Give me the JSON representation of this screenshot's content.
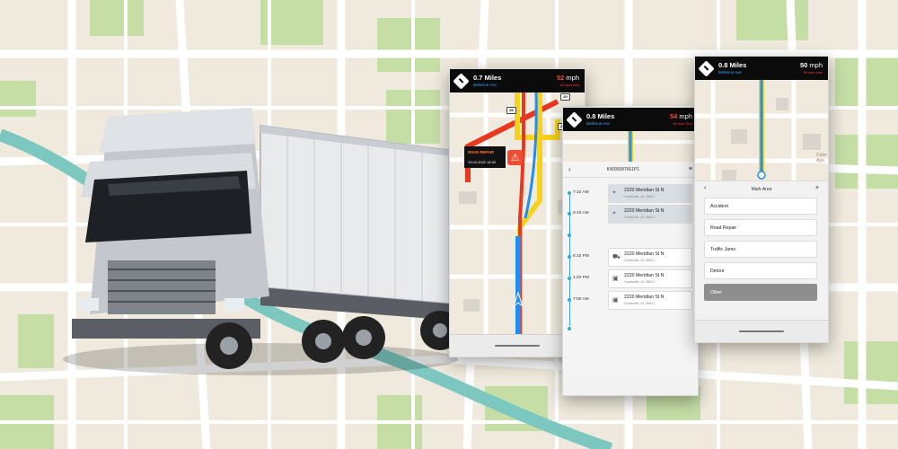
{
  "phone1": {
    "nav": {
      "distance": "0.7 Miles",
      "street": "Bellevue Ave",
      "speed_value": "52",
      "speed_unit": "mph",
      "limit": "45 mph limit"
    },
    "alert": {
      "title": "ROAD REPAIR",
      "datetime": "19.02.2022 18:32"
    },
    "route_tags": [
      "26",
      "20",
      "25"
    ]
  },
  "phone2": {
    "nav": {
      "distance": "0.8 Miles",
      "street": "Bellevue Ave",
      "speed_value": "54",
      "speed_unit": "mph",
      "limit": "50 mph limit"
    },
    "schedule": {
      "id": "KW00687661P1",
      "stops": [
        {
          "time": "7:10 AM",
          "address": "2220 Meridian St N",
          "city": "Huntsville, AL 35811"
        },
        {
          "time": "9:10 AM",
          "address": "2220 Meridian St N",
          "city": "Huntsville, AL 35811"
        },
        {
          "time": "6:15 PM",
          "address": "2220 Meridian St N",
          "city": "Huntsville, AL 35811"
        },
        {
          "time": "1:20 PM",
          "address": "2220 Meridian St N",
          "city": "Huntsville, AL 35811"
        },
        {
          "time": "7:00 AM",
          "address": "2220 Meridian St N",
          "city": "Huntsville, AL 35811"
        }
      ]
    }
  },
  "phone3": {
    "nav": {
      "distance": "0.8 Miles",
      "street": "Bellevue Ave",
      "speed_value": "50",
      "speed_unit": "mph",
      "limit": "50 mph limit"
    },
    "sheet": {
      "title": "Mark Area",
      "options": [
        "Accident",
        "Road Repair",
        "Traffic Jams",
        "Detour",
        "Other"
      ],
      "selected_index": 4
    },
    "map_label_line1": "Color",
    "map_label_line2": "Apa"
  },
  "colors": {
    "route_blue": "#1f8ff5",
    "route_yellow": "#f6d21b",
    "route_red": "#e8381f",
    "alert_orange": "#ef4d32",
    "river": "#7cc8c0",
    "park": "#c5dea6"
  },
  "icons": [
    "turn-right-icon",
    "road-repair-icon",
    "back-arrow-icon",
    "menu-icon",
    "close-icon",
    "nav-arrow-icon"
  ]
}
